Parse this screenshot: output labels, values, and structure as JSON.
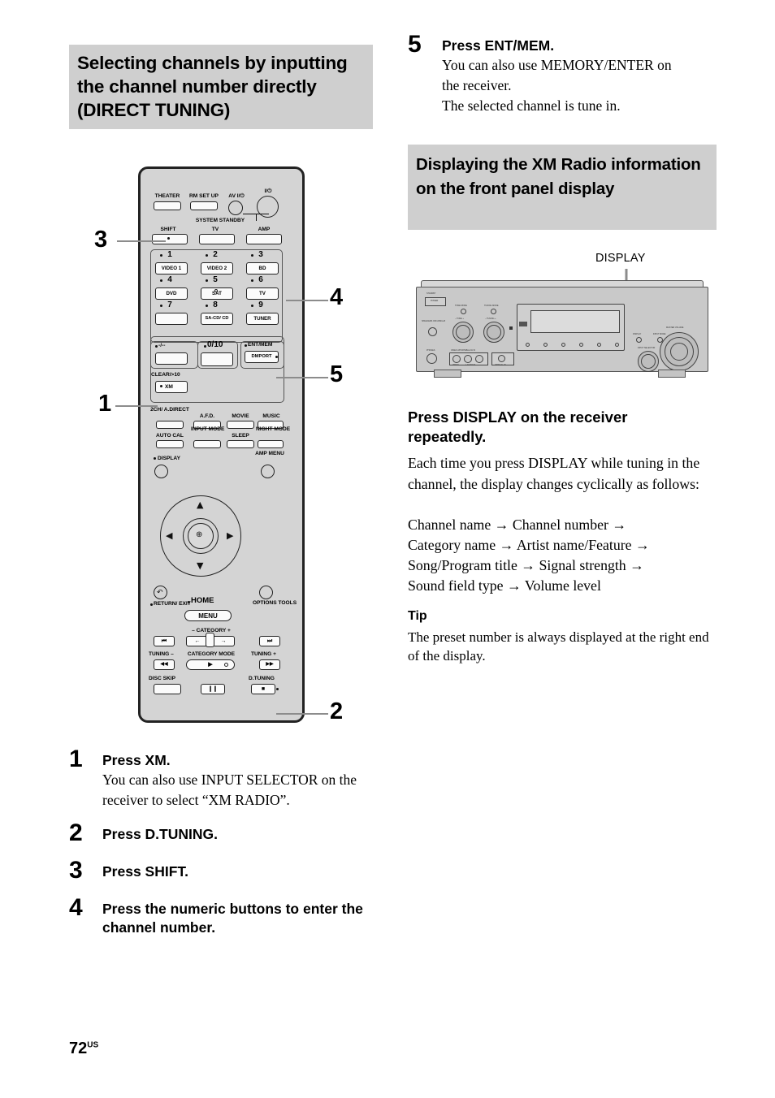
{
  "page": {
    "number": "72",
    "region_suffix": "US"
  },
  "left_column": {
    "section_heading": "Selecting channels by inputting the channel number directly (DIRECT TUNING)",
    "steps": [
      {
        "num": "1",
        "title": "Press XM.",
        "body": "You can also use INPUT SELECTOR on the receiver to select “XM RADIO”."
      },
      {
        "num": "2",
        "title": "Press D.TUNING.",
        "body": ""
      },
      {
        "num": "3",
        "title": "Press SHIFT.",
        "body": ""
      },
      {
        "num": "4",
        "title": "Press the numeric buttons to enter the channel number.",
        "body": ""
      }
    ]
  },
  "right_column": {
    "step5": {
      "num": "5",
      "title": "Press ENT/MEM.",
      "body_line1": "You can also use MEMORY/ENTER on",
      "body_line2": "the receiver.",
      "body_line3": "The selected channel is tune in."
    },
    "section_heading": "Displaying the XM Radio information on the front panel display",
    "receiver_callout": "DISPLAY",
    "instruction_heading": "Press DISPLAY on the receiver repeatedly.",
    "instruction_body": "Each time you press DISPLAY while tuning in the channel, the display changes cyclically as follows:",
    "cycle_lines": [
      "Channel name → Channel number →",
      "Category name → Artist name/Feature →",
      "Song/Program title → Signal strength →",
      "Sound field type → Volume level"
    ],
    "tip": {
      "label": "Tip",
      "body": "The preset number is always displayed at the right end of the display."
    }
  },
  "remote_figure": {
    "callouts": [
      "1",
      "2",
      "3",
      "4",
      "5"
    ],
    "labels": {
      "theater": "THEATER",
      "rm_set_up": "RM SET UP",
      "av_power": "AV I/⏻",
      "main_power": "I/⏻",
      "system_standby": "SYSTEM STANDBY",
      "shift": "SHIFT",
      "tv": "TV",
      "amp": "AMP",
      "n1": "1",
      "n2": "2",
      "n3": "3",
      "n4": "4",
      "n5": "5",
      "n6": "6",
      "n7": "7",
      "n8": "8",
      "n9": "9",
      "video1": "VIDEO 1",
      "video2": "VIDEO 2",
      "bd": "BD",
      "dvd": "DVD",
      "sat": "SAT",
      "tv_btn": "TV",
      "sacd_cd": "SA-CD/ CD",
      "tuner": "TUNER",
      "minus_dashes": "-/--",
      "zero_ten": "0/10",
      "ent_mem": "ENT/MEM",
      "dmport": "DMPORT",
      "clear": "CLEAR/>10",
      "xm": "XM",
      "ch2_adirect": "2CH/ A.DIRECT",
      "afd": "A.F.D.",
      "movie": "MOVIE",
      "music": "MUSIC",
      "auto_cal": "AUTO CAL",
      "input_mode": "INPUT MODE",
      "sleep": "SLEEP",
      "night_mode": "NIGHT MODE",
      "display": "DISPLAY",
      "amp_menu": "AMP MENU",
      "return_exit": "RETURN/ EXIT",
      "home": "HOME",
      "menu": "MENU",
      "options_tools": "OPTIONS TOOLS",
      "category": "– CATEGORY +",
      "tuning_minus": "TUNING –",
      "category_mode": "CATEGORY MODE",
      "tuning_plus": "TUNING +",
      "disc_skip": "DISC SKIP",
      "d_tuning": "D.TUNING",
      "prev_track": "⏮",
      "next_track": "⏭",
      "rewind": "◀◀",
      "forward": "▶▶",
      "play": "▶",
      "pause": "❙❙",
      "stop": "■",
      "cat_left": "←",
      "cat_right": "→"
    }
  },
  "receiver_figure": {
    "labels": {
      "power": "POWER",
      "standby": "STANDBY",
      "speakers": "SPEAKERS OFF/A/B/A+B",
      "tone_mode": "TONE MODE",
      "tone": "– TONE +",
      "tuning_mode": "TUNING MODE",
      "tuning": "– TUNING +",
      "phones": "PHONES",
      "video_portable_av_in": "VIDEO 2/PORTABLE AV IN",
      "video": "VIDEO",
      "l_audio_r": "L AUDIO R",
      "optical_in": "OPTICAL IN",
      "display": "DISPLAY",
      "input_mode": "INPUT MODE",
      "input_selector": "INPUT SELECTOR",
      "master_volume": "MASTER VOLUME",
      "indicators": [
        "MULTI CH IN",
        "HDMI",
        "DIGITAL",
        "A.F.D.",
        "MOVIE",
        "MUSIC"
      ]
    }
  },
  "colors": {
    "heading_band": "#cfcfcf",
    "remote_body": "#d4d4d4",
    "button_face": "#fbfbfb",
    "leader_line": "#8c8c8c",
    "text": "#000000"
  }
}
